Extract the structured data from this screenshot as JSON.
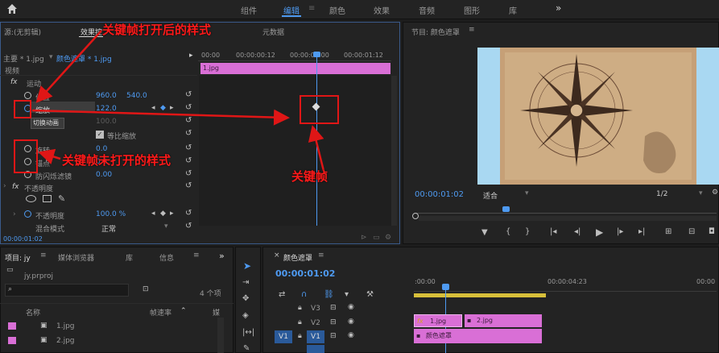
{
  "topbar": {
    "home_icon": "home-icon",
    "tabs": [
      "组件",
      "编辑",
      "颜色",
      "效果",
      "音频",
      "图形",
      "库"
    ],
    "active_tab": "编辑",
    "more": "»"
  },
  "effect_controls": {
    "source_tab": "源:(无剪辑)",
    "tab_effects": "效果控",
    "tab_metadata": "元数据",
    "master_label": "主要 * 1.jpg",
    "sequence_label": "颜色遮罩 * 1.jpg",
    "timecodes": [
      "00:00",
      "00:00:00:12",
      "00:00:01:00",
      "00:00:01:12"
    ],
    "clip_label": "1.jpg",
    "section_video": "视频",
    "motion": "运动",
    "position_label": "位置",
    "position_x": "960.0",
    "position_y": "540.0",
    "scale_label": "缩放",
    "scale_value": "122.0",
    "scale_width_value": "100.0",
    "tooltip": "切换动画",
    "uniform_scale": "等比缩放",
    "rotation_label": "旋转",
    "rotation_value": "0.0",
    "anchor_label": "锚点",
    "anchor_value": "0.0",
    "flicker_label": "防闪烁滤镜",
    "flicker_value": "0.00",
    "opacity_section": "不透明度",
    "opacity_label": "不透明度",
    "opacity_value": "100.0 %",
    "blend_label": "混合模式",
    "blend_value": "正常",
    "current_time": "00:00:01:02"
  },
  "annotations": {
    "top": "关键帧打开后的样式",
    "middle": "关键帧未打开的样式",
    "keyframe": "关键帧"
  },
  "program": {
    "title": "节目: 颜色遮罩",
    "timecode": "00:00:01:02",
    "fit": "适合",
    "resolution": "1/2"
  },
  "project": {
    "tab_project": "项目: jy",
    "tab_media": "媒体浏览器",
    "tab_library": "库",
    "tab_info": "信息",
    "project_file": "jy.prproj",
    "item_count": "4 个项",
    "col_name": "名称",
    "col_framerate": "帧速率",
    "col_extra": "媒",
    "items": [
      "1.jpg",
      "2.jpg"
    ]
  },
  "timeline": {
    "sequence_tab": "颜色遮罩",
    "timecode": "00:00:01:02",
    "ruler": [
      ":00:00",
      "00:00:04:23",
      "00:00"
    ],
    "tracks": [
      "V3",
      "V2",
      "V1"
    ],
    "source_patch": "V1",
    "clip_1": "1.jpg",
    "clip_2": "2.jpg",
    "clip_matte": "颜色遮罩",
    "fx_badge": "fx"
  },
  "colors": {
    "accent": "#4e9af1",
    "annotation": "#e01616",
    "clip": "#d96fd6"
  }
}
